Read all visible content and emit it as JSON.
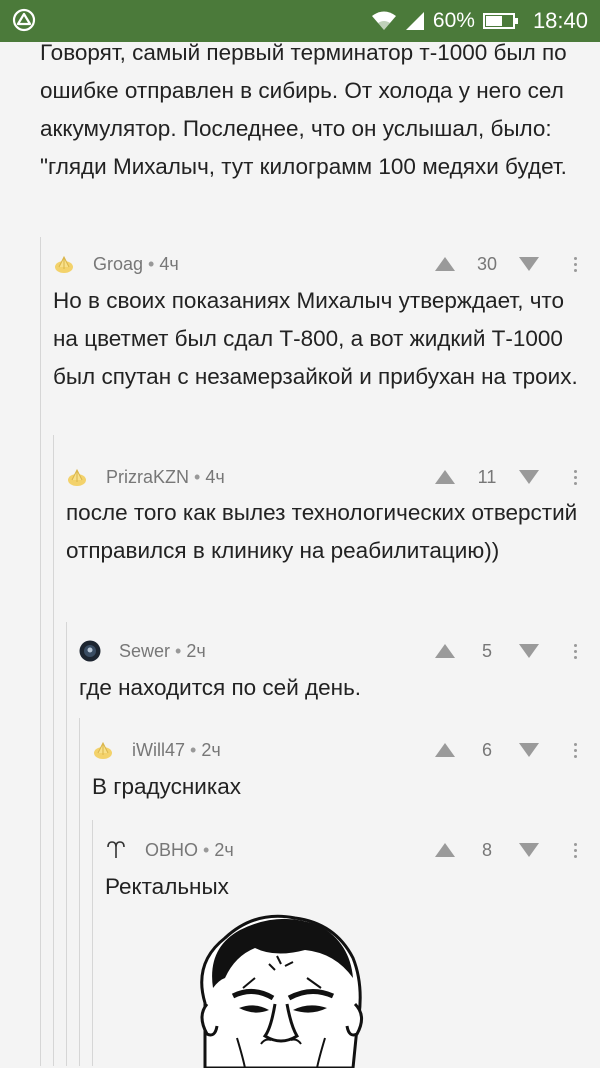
{
  "status_bar": {
    "battery": "60%",
    "time": "18:40"
  },
  "top_comment": {
    "text": "Говорят, самый первый терминатор т-1000 был по ошибке отправлен в сибирь. От холода у него сел аккумулятор. Последнее, что он услышал, было: \"гляди Михалыч, тут килограмм 100 медяхи будет."
  },
  "comments": [
    {
      "author": "Groag",
      "sep": "•",
      "time": "4ч",
      "score": "30",
      "avatar": "folded-hands-icon",
      "text": "Но в своих показаниях Михалыч утверждает, что на цветмет был сдал Т-800, а вот жидкий Т-1000 был спутан с незамерзайкой и прибухан на троих."
    },
    {
      "author": "PrizraKZN",
      "sep": "•",
      "time": "4ч",
      "score": "11",
      "avatar": "folded-hands-icon",
      "text": "после того как вылез технологических отверстий отправился в клинику на реабилитацию))"
    },
    {
      "author": "Sewer",
      "sep": "•",
      "time": "2ч",
      "score": "5",
      "avatar": "dark-circle-avatar-icon",
      "text": "где находится по сей день."
    },
    {
      "author": "iWill47",
      "sep": "•",
      "time": "2ч",
      "score": "6",
      "avatar": "folded-hands-icon",
      "text": "В градусниках"
    },
    {
      "author": "ОВНО",
      "sep": "•",
      "time": "2ч",
      "score": "8",
      "avatar": "aries-symbol-icon",
      "text": "Ректальных"
    }
  ],
  "colors": {
    "status_bar": "#4b7a3a",
    "background": "#f4f4f4",
    "meta": "#777777",
    "thread_line": "#d6d6d6"
  }
}
